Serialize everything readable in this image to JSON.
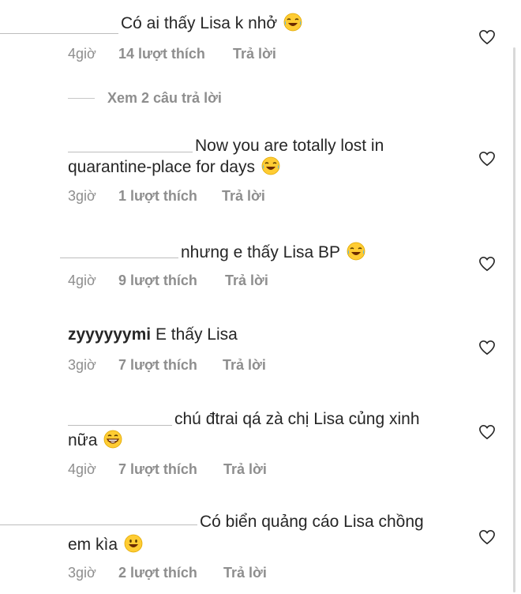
{
  "comments": [
    {
      "lines": [
        "Có ai thấy Lisa k nhở"
      ],
      "emoji": "laughing-tears",
      "time": "4giờ",
      "likes": "14 lượt thích",
      "reply": "Trả lời"
    },
    {
      "lines": [
        "Now you are totally lost in",
        "quarantine-place for days"
      ],
      "emoji": "laughing-tears",
      "time": "3giờ",
      "likes": "1 lượt thích",
      "reply": "Trả lời"
    },
    {
      "lines": [
        "nhưng e thấy Lisa BP"
      ],
      "emoji": "laughing-tears",
      "time": "4giờ",
      "likes": "9 lượt thích",
      "reply": "Trả lời"
    },
    {
      "username": "zyyyyyymi",
      "lines": [
        "E thấy Lisa"
      ],
      "time": "3giờ",
      "likes": "7 lượt thích",
      "reply": "Trả lời"
    },
    {
      "lines": [
        "chú đtrai qá zà chị Lisa củng xinh",
        "nữa"
      ],
      "emoji": "grinning",
      "time": "4giờ",
      "likes": "7 lượt thích",
      "reply": "Trả lời"
    },
    {
      "lines": [
        "Có biển quảng cáo Lisa chồng",
        "em kìa"
      ],
      "emoji": "smiling",
      "time": "3giờ",
      "likes": "2 lượt thích",
      "reply": "Trả lời"
    }
  ],
  "view_replies": "Xem 2 câu trả lời",
  "icons": {
    "like": "heart-outline-icon"
  }
}
